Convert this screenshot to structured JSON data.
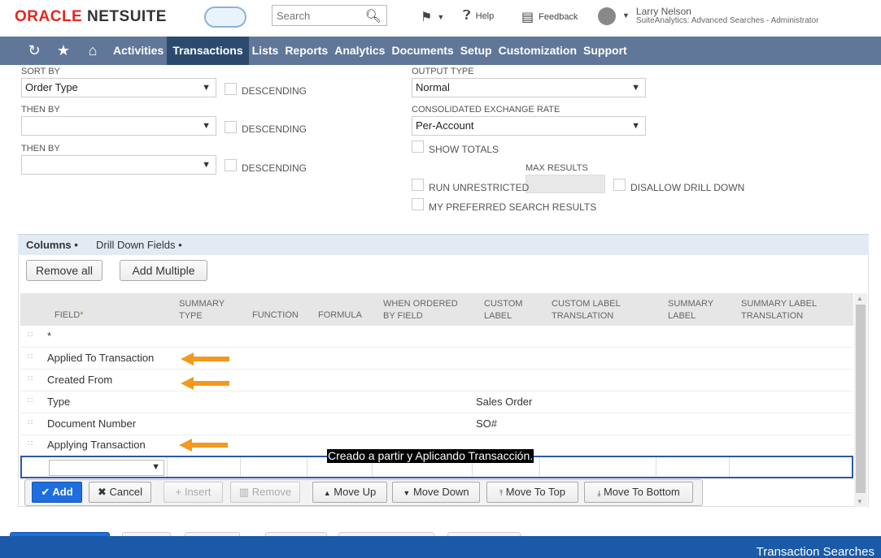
{
  "header": {
    "logo_oracle": "ORACLE",
    "logo_netsuite": "NETSUITE",
    "search_placeholder": "Search",
    "help": "Help",
    "feedback": "Feedback",
    "user_name": "Larry Nelson",
    "user_role": "SuiteAnalytics: Advanced Searches - Administrator"
  },
  "nav": {
    "items": [
      "Activities",
      "Transactions",
      "Lists",
      "Reports",
      "Analytics",
      "Documents",
      "Setup",
      "Customization",
      "Support"
    ],
    "active": "Transactions"
  },
  "form": {
    "sort_by_label": "SORT BY",
    "sort_by_value": "Order Type",
    "then_by_label_1": "THEN BY",
    "then_by_label_2": "THEN BY",
    "descending": "DESCENDING",
    "output_type_label": "OUTPUT TYPE",
    "output_type_value": "Normal",
    "exchange_rate_label": "CONSOLIDATED EXCHANGE RATE",
    "exchange_rate_value": "Per-Account",
    "show_totals": "SHOW TOTALS",
    "max_results_label": "MAX RESULTS",
    "run_unrestricted": "RUN UNRESTRICTED",
    "disallow_drill_down": "DISALLOW DRILL DOWN",
    "preferred_search_results": "MY PREFERRED SEARCH RESULTS"
  },
  "tabs": {
    "columns": "Columns",
    "drill_down": "Drill Down Fields",
    "dot": "•"
  },
  "buttons": {
    "remove_all": "Remove all",
    "add_multiple": "Add Multiple",
    "add": "Add",
    "cancel": "Cancel",
    "insert": "Insert",
    "remove": "Remove",
    "move_up": "Move Up",
    "move_down": "Move Down",
    "move_to_top": "Move To Top",
    "move_to_bottom": "Move To Bottom"
  },
  "grid": {
    "headers": [
      {
        "l1": "FIELD",
        "l2": ""
      },
      {
        "l1": "SUMMARY",
        "l2": "TYPE"
      },
      {
        "l1": "FUNCTION",
        "l2": ""
      },
      {
        "l1": "FORMULA",
        "l2": ""
      },
      {
        "l1": "WHEN ORDERED",
        "l2": "BY FIELD"
      },
      {
        "l1": "CUSTOM",
        "l2": "LABEL"
      },
      {
        "l1": "CUSTOM LABEL",
        "l2": "TRANSLATION"
      },
      {
        "l1": "SUMMARY",
        "l2": "LABEL"
      },
      {
        "l1": "SUMMARY LABEL",
        "l2": "TRANSLATION"
      }
    ],
    "required_star": "*",
    "rows": [
      {
        "field": "*",
        "custom_label": ""
      },
      {
        "field": "Applied To Transaction",
        "custom_label": ""
      },
      {
        "field": "Created From",
        "custom_label": ""
      },
      {
        "field": "Type",
        "custom_label": "Sales Order"
      },
      {
        "field": "Document Number",
        "custom_label": "SO#"
      },
      {
        "field": "Applying Transaction",
        "custom_label": ""
      }
    ]
  },
  "caption": "Creado a partir y Aplicando Transacción.",
  "footer": "Transaction Searches",
  "colors": {
    "nav_bg": "#607799",
    "nav_active": "#2c4a6e",
    "arrow": "#f39a1e",
    "primary": "#1e6ee0",
    "footer": "#1a5aa8"
  }
}
